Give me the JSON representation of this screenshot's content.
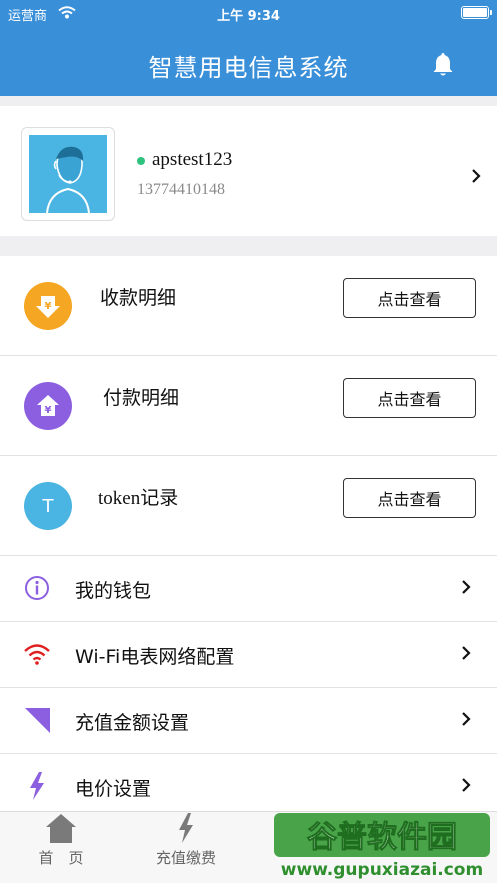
{
  "status_bar": {
    "carrier": "运营商",
    "time": "上午 9:34"
  },
  "header": {
    "title": "智慧用电信息系统",
    "bell_icon": "bell-icon"
  },
  "profile": {
    "username": "apstest123",
    "phone": "13774410148",
    "online_color": "#2ec27e"
  },
  "records": [
    {
      "label": "收款明细",
      "button": "点击查看",
      "icon": "yuan-down-icon",
      "color": "#f5a623"
    },
    {
      "label": "付款明细",
      "button": "点击查看",
      "icon": "yuan-home-icon",
      "color": "#8b5fe0"
    },
    {
      "label": "token记录",
      "button": "点击查看",
      "icon": "token-t-icon",
      "icon_text": "T",
      "color": "#4ab4e2"
    }
  ],
  "settings": [
    {
      "label": "我的钱包",
      "icon": "info-circle-icon"
    },
    {
      "label": "Wi-Fi电表网络配置",
      "icon": "wifi-icon"
    },
    {
      "label": "充值金额设置",
      "icon": "triangle-icon"
    },
    {
      "label": "电价设置",
      "icon": "lightning-icon"
    }
  ],
  "tabbar": {
    "tabs": [
      {
        "label": "首　页",
        "icon": "home-icon"
      },
      {
        "label": "充值缴费",
        "icon": "lightning-icon"
      }
    ]
  },
  "watermark": {
    "title": "谷普软件园",
    "url": "www.gupuxiazai.com"
  },
  "colors": {
    "header": "#3a8fd9",
    "accent_purple": "#8b5fe0",
    "wifi_red": "#e02020"
  }
}
